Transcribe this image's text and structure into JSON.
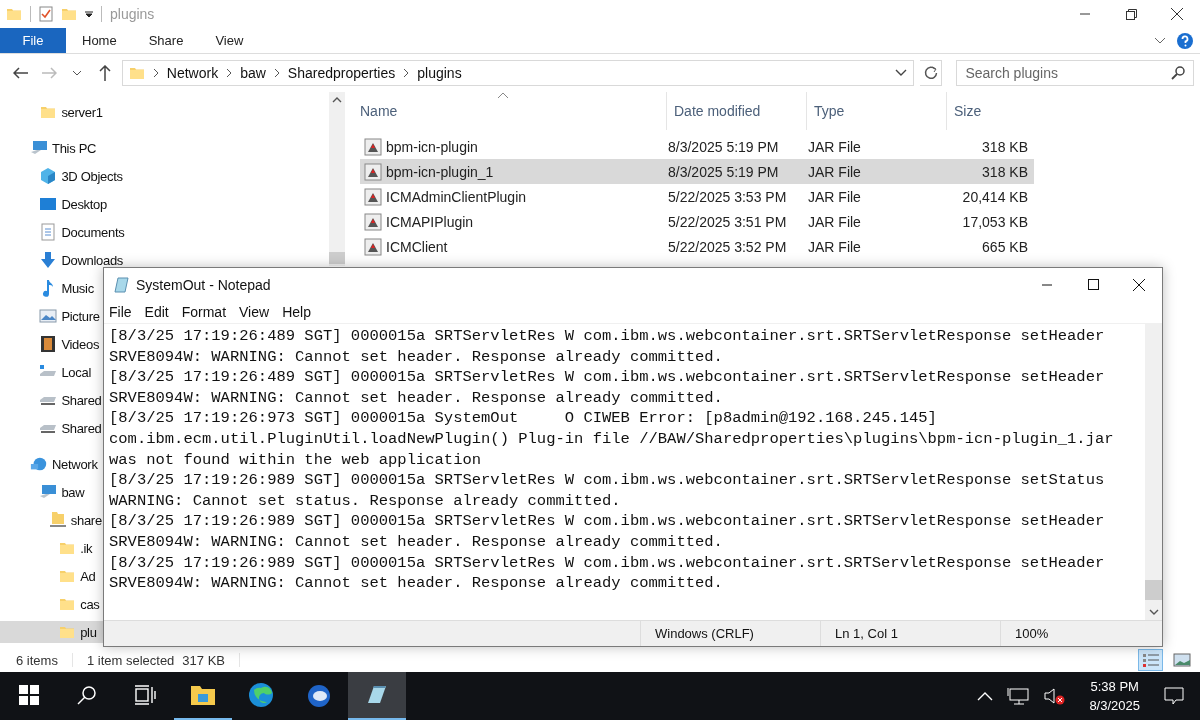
{
  "explorer": {
    "title": "plugins",
    "file_tab": "File",
    "ribbon_tabs": [
      "Home",
      "Share",
      "View"
    ],
    "address": [
      "Network",
      "baw",
      "Sharedproperties",
      "plugins"
    ],
    "search": {
      "placeholder": "Search plugins"
    },
    "quick_access": [
      {
        "label": "server1",
        "kind": "folder",
        "selected": false
      }
    ],
    "tree": [
      {
        "label": "This PC",
        "kind": "pc",
        "selected": false,
        "children": [
          {
            "label": "3D Objects",
            "kind": "objects",
            "selected": false
          },
          {
            "label": "Desktop",
            "kind": "desktop",
            "selected": false
          },
          {
            "label": "Documents",
            "kind": "documents",
            "selected": false
          },
          {
            "label": "Downloads",
            "kind": "downloads",
            "selected": false
          },
          {
            "label": "Music",
            "kind": "music",
            "selected": false
          },
          {
            "label": "Picture",
            "kind": "pictures",
            "selected": false
          },
          {
            "label": "Videos",
            "kind": "videos",
            "selected": false
          },
          {
            "label": "Local",
            "kind": "localdrive",
            "selected": false
          },
          {
            "label": "Shared",
            "kind": "netdrive",
            "selected": false
          },
          {
            "label": "Shared",
            "kind": "netdrive",
            "selected": false
          }
        ]
      },
      {
        "label": "Network",
        "kind": "network",
        "selected": false,
        "children": [
          {
            "label": "baw",
            "kind": "pc",
            "selected": false,
            "children": [
              {
                "label": "share",
                "kind": "share",
                "selected": false,
                "children": [
                  {
                    "label": ".ik",
                    "kind": "folder",
                    "selected": false
                  },
                  {
                    "label": "Ad",
                    "kind": "folder",
                    "selected": false
                  },
                  {
                    "label": "cas",
                    "kind": "folder",
                    "selected": false
                  },
                  {
                    "label": "plu",
                    "kind": "folder",
                    "selected": true
                  }
                ]
              }
            ]
          }
        ]
      }
    ],
    "columns": [
      "Name",
      "Date modified",
      "Type",
      "Size"
    ],
    "rows": [
      {
        "name": "bpm-icn-plugin",
        "date": "8/3/2025 5:19 PM",
        "type": "JAR File",
        "size": "318 KB",
        "selected": false
      },
      {
        "name": "bpm-icn-plugin_1",
        "date": "8/3/2025 5:19 PM",
        "type": "JAR File",
        "size": "318 KB",
        "selected": true
      },
      {
        "name": "ICMAdminClientPlugin",
        "date": "5/22/2025 3:53 PM",
        "type": "JAR File",
        "size": "20,414 KB",
        "selected": false
      },
      {
        "name": "ICMAPIPlugin",
        "date": "5/22/2025 3:51 PM",
        "type": "JAR File",
        "size": "17,053 KB",
        "selected": false
      },
      {
        "name": "ICMClient",
        "date": "5/22/2025 3:52 PM",
        "type": "JAR File",
        "size": "665 KB",
        "selected": false
      }
    ],
    "status": {
      "count": "6 items",
      "selection": "1 item selected",
      "size": "317 KB"
    }
  },
  "notepad": {
    "title": "SystemOut - Notepad",
    "menu": [
      "File",
      "Edit",
      "Format",
      "View",
      "Help"
    ],
    "lines": [
      "[8/3/25 17:19:26:489 SGT] 0000015a SRTServletRes W com.ibm.ws.webcontainer.srt.SRTServletResponse setHeader",
      "SRVE8094W: WARNING: Cannot set header. Response already committed.",
      "[8/3/25 17:19:26:489 SGT] 0000015a SRTServletRes W com.ibm.ws.webcontainer.srt.SRTServletResponse setHeader",
      "SRVE8094W: WARNING: Cannot set header. Response already committed.",
      "[8/3/25 17:19:26:973 SGT] 0000015a SystemOut     O CIWEB Error: [p8admin@192.168.245.145]",
      "com.ibm.ecm.util.PluginUtil.loadNewPlugin() Plug-in file //BAW/Sharedproperties\\plugins\\bpm-icn-plugin_1.jar",
      "was not found within the web application",
      "[8/3/25 17:19:26:989 SGT] 0000015a SRTServletRes W com.ibm.ws.webcontainer.srt.SRTServletResponse setStatus",
      "WARNING: Cannot set status. Response already committed.",
      "[8/3/25 17:19:26:989 SGT] 0000015a SRTServletRes W com.ibm.ws.webcontainer.srt.SRTServletResponse setHeader",
      "SRVE8094W: WARNING: Cannot set header. Response already committed.",
      "[8/3/25 17:19:26:989 SGT] 0000015a SRTServletRes W com.ibm.ws.webcontainer.srt.SRTServletResponse setHeader",
      "SRVE8094W: WARNING: Cannot set header. Response already committed."
    ],
    "status": [
      "Windows (CRLF)",
      "Ln 1, Col 1",
      "100%"
    ]
  },
  "taskbar": {
    "apps": [
      {
        "kind": "explorer",
        "running": true,
        "active": false
      },
      {
        "kind": "edge",
        "running": false,
        "active": false
      },
      {
        "kind": "thunderbird",
        "running": false,
        "active": false
      },
      {
        "kind": "notepad",
        "running": true,
        "active": true
      }
    ],
    "time": "5:38 PM",
    "date": "8/3/2025"
  }
}
